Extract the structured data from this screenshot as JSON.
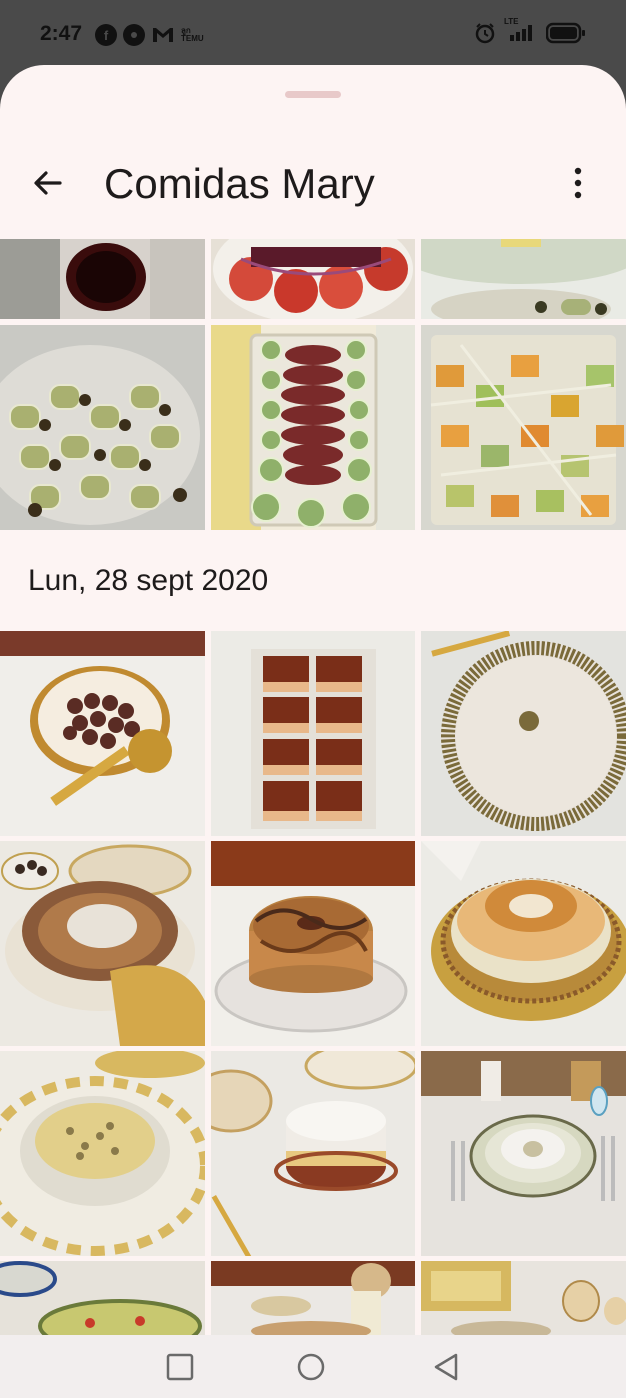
{
  "status_bar": {
    "time": "2:47",
    "app_icons": [
      "facebook-icon",
      "chrome-icon",
      "gmail-icon",
      "temu-icon"
    ],
    "temu_text": "ลูก TEMU",
    "network": "LTE",
    "right_icons": [
      "alarm-icon",
      "signal-icon",
      "battery-icon"
    ]
  },
  "header": {
    "title": "Comidas Mary",
    "back_icon": "arrow-back-icon",
    "menu_icon": "more-vert-icon"
  },
  "section": {
    "date_label": "Lun, 28 sept 2020"
  },
  "photos_top": [
    {
      "desc": "vino",
      "c": "#6b1a1a"
    },
    {
      "desc": "ensalada tomate",
      "c": "#c8463a"
    },
    {
      "desc": "bandeja",
      "c": "#cfd3c2"
    },
    {
      "desc": "rollitos calabacín",
      "c": "#b6ae76"
    },
    {
      "desc": "carne pepino",
      "c": "#6a2a2a"
    },
    {
      "desc": "ensalada calabaza",
      "c": "#d89a4a"
    }
  ],
  "photos_section": [
    {
      "desc": "chocolates",
      "c": "#6a4030"
    },
    {
      "desc": "pasteles chocolate",
      "c": "#7a3c20"
    },
    {
      "desc": "tarta pistacho",
      "c": "#e6dfd6"
    },
    {
      "desc": "postre",
      "c": "#9a6a3a"
    },
    {
      "desc": "bizcocho",
      "c": "#b37a40"
    },
    {
      "desc": "flan",
      "c": "#d9a25a"
    },
    {
      "desc": "mousse",
      "c": "#c9b27a"
    },
    {
      "desc": "tarta crema",
      "c": "#e0d0c0"
    },
    {
      "desc": "mesa",
      "c": "#bfc3a8"
    },
    {
      "desc": "mesa 2",
      "c": "#c8b8a0"
    },
    {
      "desc": "mesa 3",
      "c": "#b89a70"
    },
    {
      "desc": "mesa 4",
      "c": "#d6c8b0"
    }
  ],
  "nav_bar": {
    "buttons": [
      "recent-apps-icon",
      "home-icon",
      "back-icon"
    ]
  },
  "colors": {
    "sheet_bg": "#fdf4f3",
    "status_bg": "#4a4a4a",
    "title_text": "#1e1b1b",
    "handle": "#e8c9c9"
  }
}
